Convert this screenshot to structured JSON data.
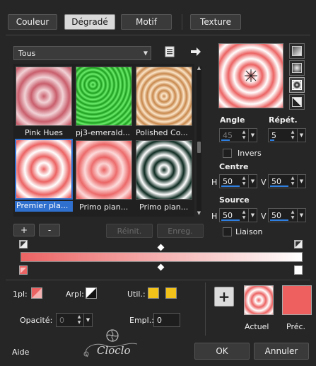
{
  "tabs": [
    "Couleur",
    "Dégradé",
    "Motif",
    "Texture"
  ],
  "gallery": {
    "category": "Tous",
    "items": [
      {
        "label": "Pink Hues"
      },
      {
        "label": "pj3-emerald..."
      },
      {
        "label": "Polished Co..."
      },
      {
        "label": "Premier pla..."
      },
      {
        "label": "Primo pian..."
      },
      {
        "label": "Primo pian..."
      }
    ]
  },
  "buttons": {
    "add": "+",
    "remove": "-",
    "reset": "Réinit.",
    "save": "Enreg.",
    "ok": "OK",
    "cancel": "Annuler",
    "help": "Aide"
  },
  "params": {
    "angle_label": "Angle",
    "angle_value": "45",
    "repeat_label": "Répét.",
    "repeat_value": "5",
    "invert_label": "Invers",
    "center_label": "Centre",
    "center_h_label": "H",
    "center_h": "50",
    "center_v_label": "V",
    "center_v": "50",
    "source_label": "Source",
    "source_h_label": "H",
    "source_h": "50",
    "source_v_label": "V",
    "source_v": "50",
    "link_label": "Liaison"
  },
  "bottom": {
    "first_label": "1pl:",
    "bg_label": "Arpl:",
    "util_label": "Util.:",
    "opacity_label": "Opacité:",
    "opacity_value": "0",
    "position_label": "Empl.:",
    "position_value": "0",
    "current_label": "Actuel",
    "previous_label": "Préc.",
    "watermark": "Cloclo"
  },
  "colors": {
    "accent_blue": "#2f6fce",
    "gradient_start": "#ec6363",
    "gradient_end": "#ffffff",
    "util_yellow": "#f2c21b",
    "previous": "#ee6060"
  }
}
